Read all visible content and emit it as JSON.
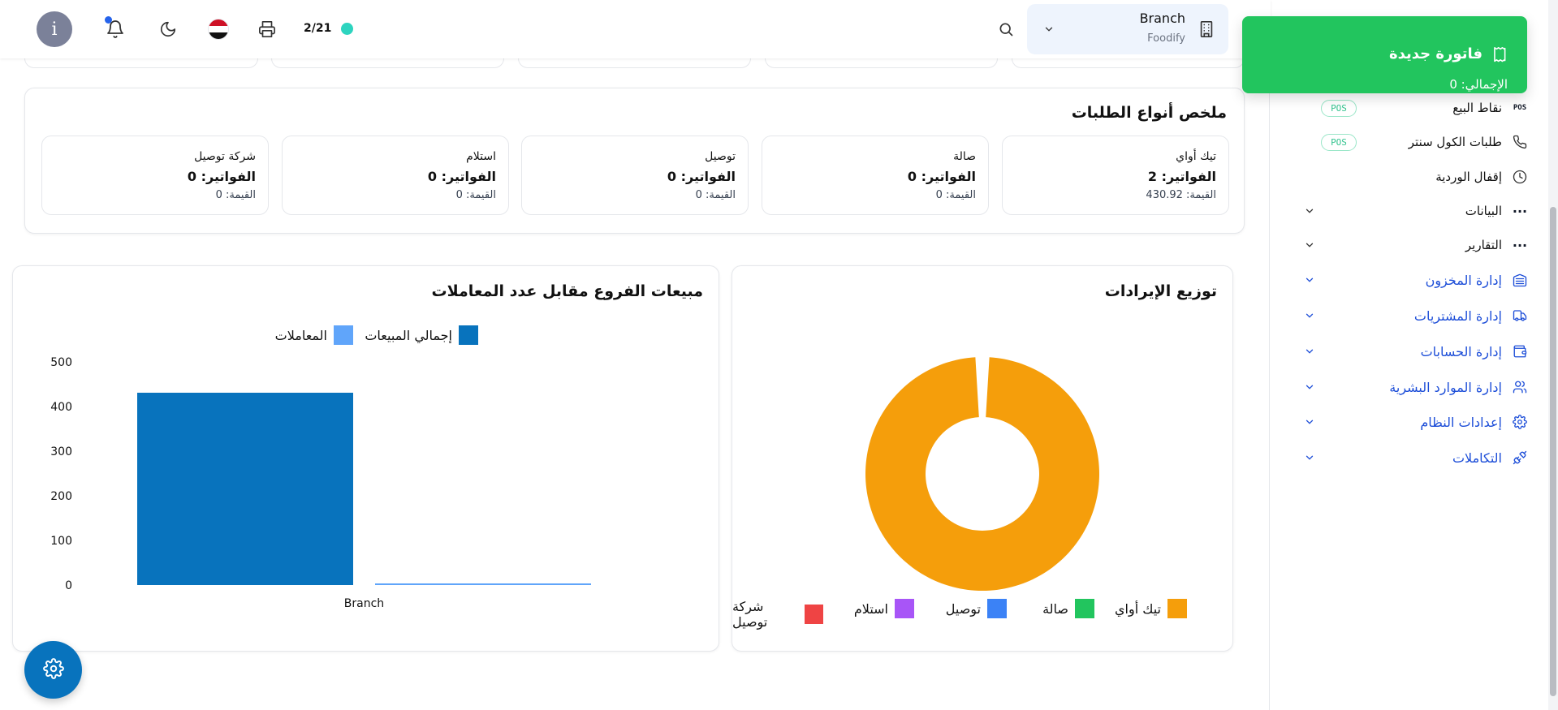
{
  "topbar": {
    "avatar_letter": "i",
    "page_count": "2/21",
    "branch": {
      "name": "Branch",
      "company": "Foodify"
    }
  },
  "toast": {
    "title": "فاتورة جديدة",
    "subtitle": "الإجمالي: 0",
    "color": "#22c55e"
  },
  "sidebar": {
    "items": [
      {
        "label": "نقاط البيع",
        "icon": "pos-icon",
        "badge": "POS"
      },
      {
        "label": "طلبات الكول سنتر",
        "icon": "phone-icon",
        "badge": "POS"
      },
      {
        "label": "إقفال الوردية",
        "icon": "clock-icon"
      },
      {
        "label": "البيانات",
        "icon": "more-dots-icon"
      },
      {
        "label": "التقارير",
        "icon": "more-dots-icon"
      },
      {
        "label": "إدارة المخزون",
        "icon": "warehouse-icon"
      },
      {
        "label": "إدارة المشتريات",
        "icon": "truck-icon"
      },
      {
        "label": "إدارة الحسابات",
        "icon": "wallet-icon"
      },
      {
        "label": "إدارة الموارد البشرية",
        "icon": "users-icon"
      },
      {
        "label": "إعدادات النظام",
        "icon": "gear-icon"
      },
      {
        "label": "التكاملات",
        "icon": "plug-icon"
      }
    ]
  },
  "summary": {
    "title": "ملخص أنواع الطلبات",
    "cards": [
      {
        "name": "تيك أواي",
        "count": "الفواتير: 2",
        "value": "القيمة: 430.92"
      },
      {
        "name": "صالة",
        "count": "الفواتير: 0",
        "value": "القيمة: 0"
      },
      {
        "name": "توصيل",
        "count": "الفواتير: 0",
        "value": "القيمة: 0"
      },
      {
        "name": "استلام",
        "count": "الفواتير: 0",
        "value": "القيمة: 0"
      },
      {
        "name": "شركة توصيل",
        "count": "الفواتير: 0",
        "value": "القيمة: 0"
      }
    ]
  },
  "charts": {
    "revenue_title": "توزيع الإيرادات",
    "branch_title": "مبيعات الفروع مقابل عدد المعاملات"
  },
  "chart_data": [
    {
      "type": "pie",
      "title": "توزيع الإيرادات",
      "categories": [
        "تيك أواي",
        "صالة",
        "توصيل",
        "استلام",
        "شركة توصيل"
      ],
      "values": [
        430.92,
        0,
        0,
        0,
        0
      ],
      "colors": [
        "#f59e0b",
        "#22c55e",
        "#3b82f6",
        "#a855f7",
        "#ef4444"
      ],
      "legend": "bottom"
    },
    {
      "type": "bar",
      "title": "مبيعات الفروع مقابل عدد المعاملات",
      "categories": [
        "Branch"
      ],
      "series": [
        {
          "name": "إجمالي المبيعات",
          "values": [
            430.92
          ],
          "color": "#0873bd"
        },
        {
          "name": "المعاملات",
          "values": [
            2
          ],
          "color": "#60a5fa"
        }
      ],
      "yticks": [
        "0",
        "100",
        "200",
        "300",
        "400",
        "500"
      ],
      "ylim": [
        0,
        500
      ],
      "grid": false,
      "legend": "top"
    }
  ]
}
